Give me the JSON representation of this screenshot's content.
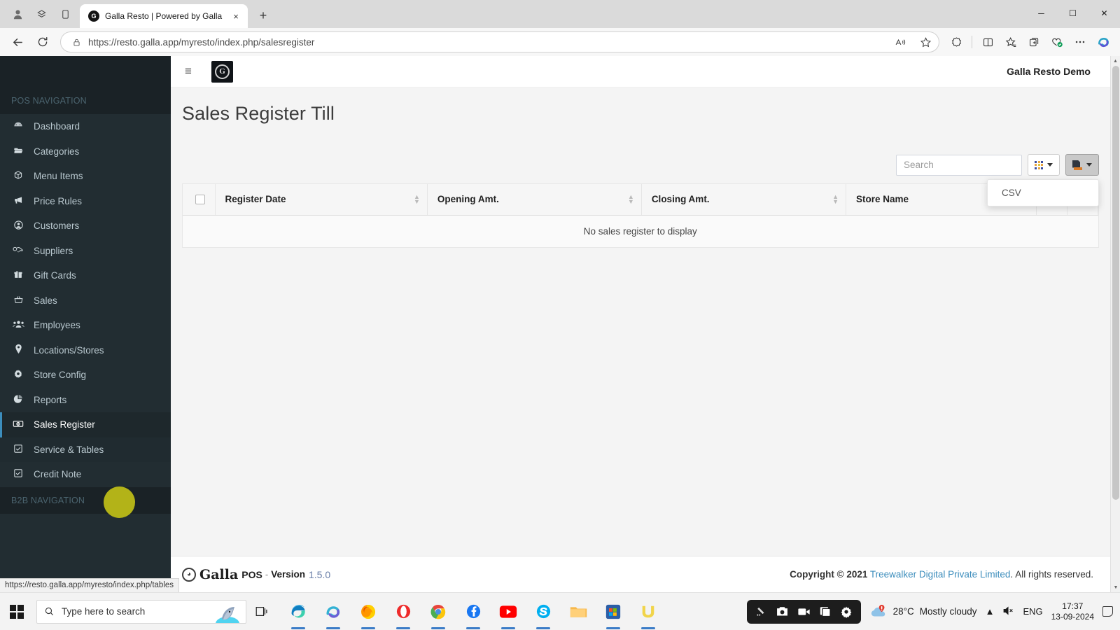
{
  "browser": {
    "tab": {
      "title": "Galla Resto | Powered by Galla",
      "favicon": "G"
    },
    "new_tab_label": "+",
    "close_tab_label": "×",
    "url": "https://resto.galla.app/myresto/index.php/salesregister",
    "window_controls": {
      "minimize": "─",
      "maximize": "☐",
      "close": "✕"
    }
  },
  "sidebar": {
    "pos_heading": "POS NAVIGATION",
    "b2b_heading": "B2B NAVIGATION",
    "items": [
      {
        "label": "Dashboard",
        "icon": "dashboard-icon"
      },
      {
        "label": "Categories",
        "icon": "folder-open-icon"
      },
      {
        "label": "Menu Items",
        "icon": "cube-icon"
      },
      {
        "label": "Price Rules",
        "icon": "bullhorn-icon"
      },
      {
        "label": "Customers",
        "icon": "user-circle-icon"
      },
      {
        "label": "Suppliers",
        "icon": "handshake-icon"
      },
      {
        "label": "Gift Cards",
        "icon": "gift-icon"
      },
      {
        "label": "Sales",
        "icon": "basket-icon"
      },
      {
        "label": "Employees",
        "icon": "users-icon"
      },
      {
        "label": "Locations/Stores",
        "icon": "map-pin-icon"
      },
      {
        "label": "Store Config",
        "icon": "gear-icon"
      },
      {
        "label": "Reports",
        "icon": "pie-chart-icon"
      },
      {
        "label": "Sales Register",
        "icon": "cash-register-icon"
      },
      {
        "label": "Service & Tables",
        "icon": "check-square-icon"
      },
      {
        "label": "Credit Note",
        "icon": "check-square-icon"
      }
    ],
    "active_index": 12,
    "accent_color": "#3c8dbc",
    "bg_color": "#222d32"
  },
  "topbar": {
    "menu_toggle_label": "≡",
    "logo_letter": "G",
    "account_name": "Galla Resto Demo"
  },
  "main": {
    "page_title": "Sales Register Till",
    "search": {
      "placeholder": "Search",
      "value": ""
    },
    "columns_button_label": "",
    "export_button_label": "",
    "export_menu": {
      "open": true,
      "items": [
        "CSV"
      ]
    },
    "table": {
      "headers": [
        "Register Date",
        "Opening Amt.",
        "Closing Amt.",
        "Store Name"
      ],
      "rows": [],
      "empty_message": "No sales register to display"
    }
  },
  "footer": {
    "brand": "Galla",
    "product": "POS",
    "separator": "-",
    "version_label": "Version",
    "version_number": "1.5.0",
    "copyright_prefix": "Copyright © 2021",
    "company_link": "Treewalker Digital Private Limited",
    "copyright_suffix": ". All rights reserved."
  },
  "status_tooltip": {
    "url": "https://resto.galla.app/myresto/index.php/tables"
  },
  "taskbar": {
    "search_placeholder": "Type here to search",
    "weather": {
      "temperature": "28°C",
      "condition": "Mostly cloudy"
    },
    "language": "ENG",
    "time": "17:37",
    "date": "13-09-2024"
  }
}
